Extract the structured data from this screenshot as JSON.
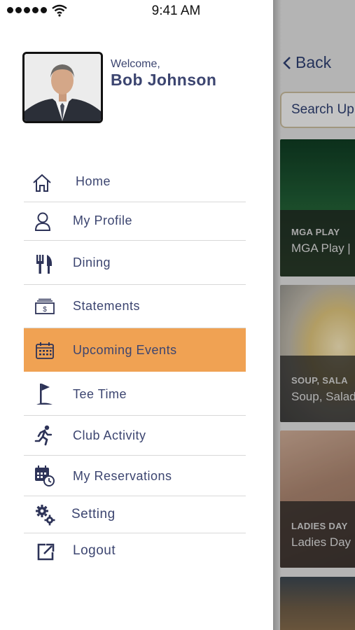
{
  "status_bar": {
    "time": "9:41 AM"
  },
  "profile": {
    "welcome": "Welcome,",
    "name": "Bob Johnson"
  },
  "menu": {
    "items": [
      {
        "label": "Home",
        "icon": "home-icon"
      },
      {
        "label": "My Profile",
        "icon": "user-icon"
      },
      {
        "label": "Dining",
        "icon": "fork-knife-icon"
      },
      {
        "label": "Statements",
        "icon": "bill-icon"
      },
      {
        "label": "Upcoming Events",
        "icon": "calendar-icon",
        "active": true
      },
      {
        "label": "Tee Time",
        "icon": "golf-flag-icon"
      },
      {
        "label": "Club Activity",
        "icon": "runner-icon"
      },
      {
        "label": "My Reservations",
        "icon": "calendar-clock-icon"
      },
      {
        "label": "Setting",
        "icon": "gears-icon"
      },
      {
        "label": "Logout",
        "icon": "logout-icon"
      }
    ]
  },
  "background": {
    "back_label": "Back",
    "search_placeholder": "Search Up",
    "cards": [
      {
        "category": "MGA PLAY",
        "title": "MGA Play |"
      },
      {
        "category": "SOUP, SALA",
        "title": "Soup, Salad"
      },
      {
        "category": "LADIES DAY",
        "title": "Ladies Day"
      }
    ]
  },
  "colors": {
    "accent": "#f0a253",
    "text": "#3c4570",
    "divider": "#d8d8d8"
  }
}
